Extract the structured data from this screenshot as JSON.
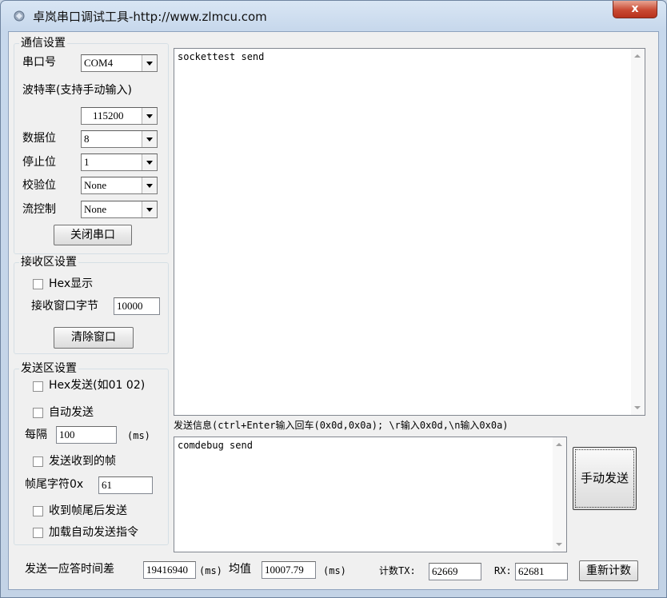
{
  "window": {
    "title": "卓岚串口调试工具-http://www.zlmcu.com",
    "close_label": "x"
  },
  "comm_settings": {
    "legend": "通信设置",
    "port_label": "串口号",
    "port_value": "COM4",
    "baud_label": "波特率(支持手动输入)",
    "baud_value": "115200",
    "databits_label": "数据位",
    "databits_value": "8",
    "stopbits_label": "停止位",
    "stopbits_value": "1",
    "parity_label": "校验位",
    "parity_value": "None",
    "flow_label": "流控制",
    "flow_value": "None",
    "close_port_button": "关闭串口"
  },
  "receive_settings": {
    "legend": "接收区设置",
    "hex_display_label": "Hex显示",
    "hex_display_checked": false,
    "window_bytes_label": "接收窗口字节",
    "window_bytes_value": "10000",
    "clear_button": "清除窗口"
  },
  "send_settings": {
    "legend": "发送区设置",
    "hex_send_label": "Hex发送(如01 02)",
    "hex_send_checked": false,
    "auto_send_label": "自动发送",
    "auto_send_checked": false,
    "interval_label": "每隔",
    "interval_value": "100",
    "interval_unit": "(ms)",
    "send_received_frame_label": "发送收到的帧",
    "send_received_frame_checked": false,
    "frame_tail_label": "帧尾字符0x",
    "frame_tail_value": "61",
    "send_after_tail_label": "收到帧尾后发送",
    "send_after_tail_checked": false,
    "load_auto_cmds_label": "加载自动发送指令",
    "load_auto_cmds_checked": false
  },
  "receive_area": {
    "content": "sockettest send"
  },
  "send_area": {
    "hint": "发送信息(ctrl+Enter输入回车(0x0d,0x0a); \\r输入0x0d,\\n输入0x0a)",
    "content": "comdebug send",
    "manual_send_button": "手动发送"
  },
  "status_bar": {
    "response_time_label": "发送一应答时间差",
    "response_time_value": "19416940",
    "ms_label_1": "(ms)",
    "average_label": "均值",
    "average_value": "10007.79",
    "ms_label_2": "(ms)",
    "count_tx_label": "计数TX:",
    "tx_value": "62669",
    "rx_label": "RX:",
    "rx_value": "62681",
    "recount_button": "重新计数"
  },
  "colors": {
    "window_frame": "#c7d8ec",
    "client_bg": "#f0f0f0",
    "close_button": "#c94a33"
  }
}
